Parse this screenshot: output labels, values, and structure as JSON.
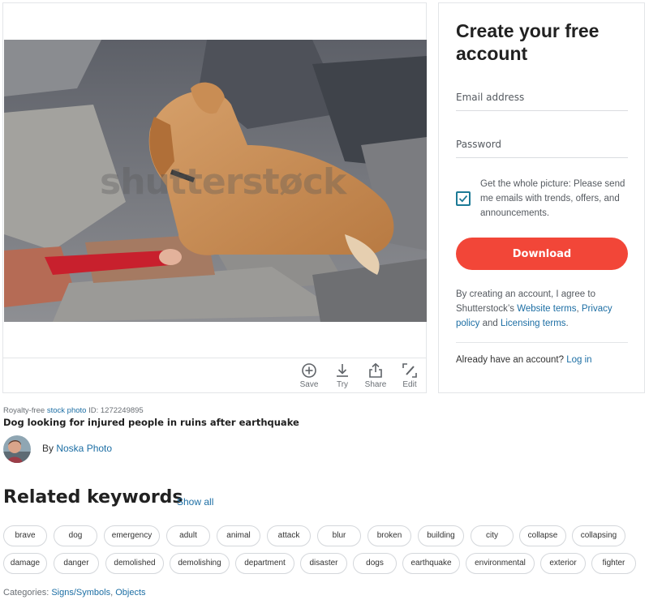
{
  "image": {
    "watermark": "shutterstøck",
    "actions": [
      {
        "label": "Save",
        "icon": "plus-circle-icon"
      },
      {
        "label": "Try",
        "icon": "download-icon"
      },
      {
        "label": "Share",
        "icon": "share-icon"
      },
      {
        "label": "Edit",
        "icon": "edit-icon"
      }
    ]
  },
  "signup": {
    "title": "Create your free account",
    "email_placeholder": "Email address",
    "password_placeholder": "Password",
    "checkbox_checked": true,
    "checkbox_text": "Get the whole picture: Please send me emails with trends, offers, and announcements.",
    "download_label": "Download",
    "terms_prefix": "By creating an account, I agree to Shutterstock’s ",
    "terms_link_website": "Website terms",
    "terms_comma": ", ",
    "terms_link_privacy": "Privacy policy",
    "terms_and": " and ",
    "terms_link_licensing": "Licensing terms",
    "terms_end": ".",
    "login_prompt": "Already have an account? ",
    "login_link": "Log in"
  },
  "info": {
    "royalty_prefix": "Royalty-free ",
    "stock_photo_link": "stock photo",
    "id_text": " ID: 1272249895",
    "title": "Dog looking for injured people in ruins after earthquake",
    "by_prefix": "By ",
    "author": "Noska Photo"
  },
  "related": {
    "title": "Related keywords",
    "show_all": "Show all",
    "row1": [
      "brave",
      "dog",
      "emergency",
      "adult",
      "animal",
      "attack",
      "blur",
      "broken",
      "building",
      "city",
      "collapse",
      "collapsing"
    ],
    "row2": [
      "damage",
      "danger",
      "demolished",
      "demolishing",
      "department",
      "disaster",
      "dogs",
      "earthquake",
      "environmental",
      "exterior",
      "fighter"
    ]
  },
  "categories": {
    "prefix": "Categories: ",
    "items": [
      "Signs/Symbols",
      "Objects"
    ],
    "sep": ", "
  },
  "colors": {
    "accent_red": "#f24638",
    "link_blue": "#1c6ea4",
    "check_teal": "#1c7a96"
  }
}
